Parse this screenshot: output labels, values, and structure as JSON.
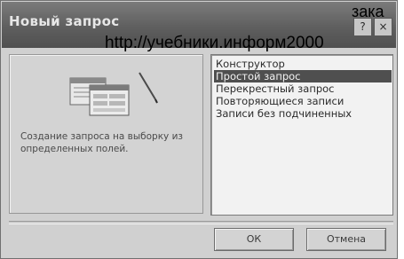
{
  "window": {
    "title": "Новый запрос",
    "controls": [
      "?",
      "×"
    ]
  },
  "overlay": {
    "url": "http://учебники.информ2000",
    "top_text": "зака"
  },
  "left_panel": {
    "illustration_icon": "query-wizard-illustration",
    "description": "Создание запроса на выборку из определенных полей."
  },
  "query_types": [
    {
      "label": "Конструктор",
      "selected": false
    },
    {
      "label": "Простой запрос",
      "selected": true
    },
    {
      "label": "Перекрестный запрос",
      "selected": false
    },
    {
      "label": "Повторяющиеся записи",
      "selected": false
    },
    {
      "label": "Записи без подчиненных",
      "selected": false
    }
  ],
  "buttons": {
    "ok_label": "ОК",
    "cancel_label": "Отмена"
  }
}
